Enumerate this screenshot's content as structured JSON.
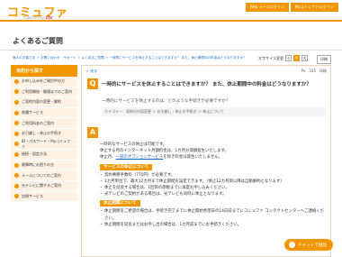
{
  "header": {
    "logo": "コミュファ",
    "logo_sub_prefix": "Powered by",
    "logo_sub_brand": "ctc",
    "links": [
      "Web メールログイン",
      "Myコミュファ/ログイン"
    ]
  },
  "page_title": "よくあるご質問",
  "breadcrumb": "個人のお客さま ＞ お問い合わせ・サポート ＞ よくあるご質問 ＞ 一時的にサービスを休止することはできますか？ また、休止期間中の料金はどうなりますか？",
  "font_size": {
    "label": "文字サイズ変更",
    "options": [
      "小",
      "中",
      "大"
    ],
    "active": "中"
  },
  "print_label": "印刷",
  "sidebar": {
    "heading": "目的から探す",
    "items": [
      "お申し込みをご検討中の方",
      "ご利用開始・開通までのご案内",
      "ご契約内容の変更・解約",
      "各種サービス",
      "ご利用料金のご案内",
      "お引越し・休止の手続き",
      "ID・パスワード・Myコミュファ",
      "接続・設定方法",
      "故障時にお困りの方",
      "メールについてのご案内",
      "光テレビに関するご案内",
      "訪問サービス"
    ]
  },
  "main": {
    "back": "＜ 戻る",
    "pv": "Pv：335　印刷",
    "question": "一時的にサービスを休止することはできますか？ また、休止期間中の料金はどうなりますか？",
    "question_sub": "一時的にサービスを休止するのは、どのような手続きが必要ですか？",
    "category": "カテゴリー：契約の内容変更 ＞ お引越し・休止の手続き ＞ 休止について",
    "answer_intro": [
      "一時的なサービスの休止は可能です。",
      "休止する月のインターネット月額料金は、1カ月分満額発生いたします。"
    ],
    "answer_link_prefix": "休止月、",
    "answer_link": "一部のオプションサービス",
    "answer_link_suffix": "を除き料金は発生いたしません。",
    "section1_head": "サービスの休止について",
    "section1_items": [
      "契約事務手数料（770円）が必要です。",
      "1カ月単位で、最大12カ月まで休止期間を設定できます。（休止12カ月目以降は自動解約となります）",
      "休止を延長する場合は、1回目の期限までに再度お申し込みください。",
      "光テレビのご契約がある場合は、光テレビも同時に休止となります。"
    ],
    "section2_head": "休止期間について",
    "section2_items": [
      "休止期間をご希望の場合は、手続き完了までに休止開始希望日の14日前までにコミュファ コンタクトセンターへご連絡ください。",
      "休止期間を延長またはお申し出の場合は、1カ月前までにお手続きください。"
    ]
  },
  "chat_label": "チャットで相談"
}
